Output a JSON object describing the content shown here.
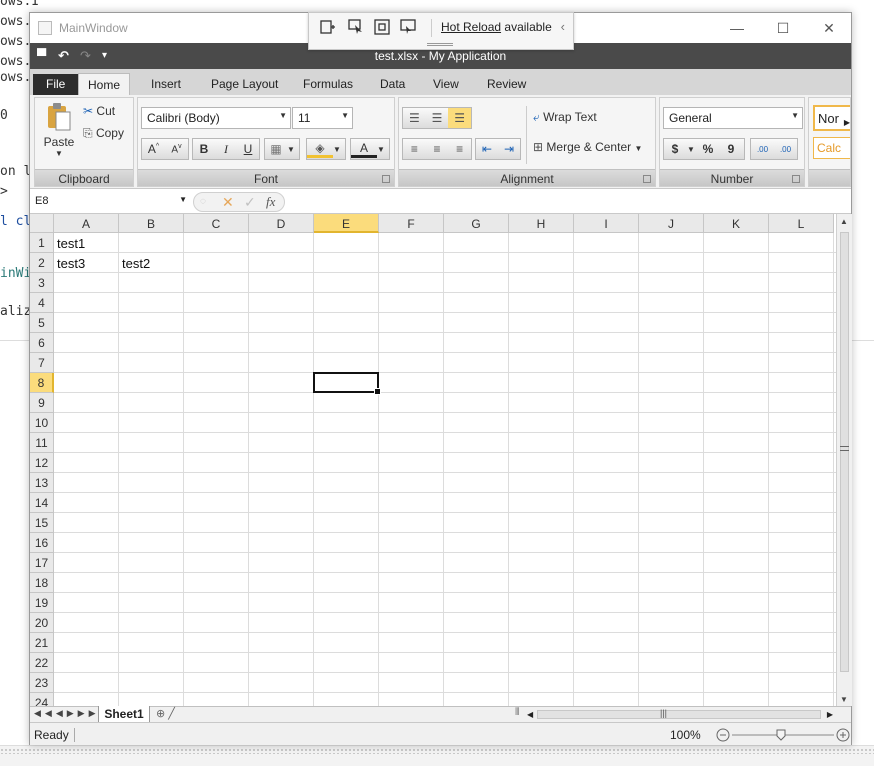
{
  "background": {
    "code_lines": [
      "ows.Input;",
      "ows.",
      "ows.",
      "ows.",
      "ows.",
      "0",
      "on l",
      ">",
      "l cl",
      "inWi",
      "aliz"
    ]
  },
  "window": {
    "title": "MainWindow",
    "minimize_glyph": "—",
    "maximize_glyph": "☐",
    "close_glyph": "✕"
  },
  "hot_reload": {
    "link": "Hot Reload",
    "text": "available",
    "chevron": "‹"
  },
  "qat": {
    "document_title": "test.xlsx - My Application",
    "save_glyph": "▀",
    "undo_glyph": "↶",
    "redo_glyph": "↷",
    "customize_glyph": "▾"
  },
  "tabs": [
    "File",
    "Home",
    "Insert",
    "Page Layout",
    "Formulas",
    "Data",
    "View",
    "Review"
  ],
  "ribbon": {
    "clipboard": {
      "label": "Clipboard",
      "paste": "Paste",
      "cut": "Cut",
      "copy": "Copy"
    },
    "font": {
      "label": "Font",
      "family": "Calibri (Body)",
      "size": "11",
      "bold": "B",
      "italic": "I",
      "underline": "U",
      "font_color": "A"
    },
    "alignment": {
      "label": "Alignment",
      "wrap_text": "Wrap Text",
      "merge_center": "Merge & Center"
    },
    "number": {
      "label": "Number",
      "format": "General",
      "currency": "$",
      "percent": "%",
      "comma": "9",
      "inc_decimal": ".00",
      "dec_decimal": ".00"
    },
    "styles": {
      "normal": "Nor",
      "calc": "Calc"
    }
  },
  "formula_bar": {
    "name_box": "E8",
    "cancel_glyph": "✕",
    "enter_glyph": "✓",
    "fx": "fx",
    "content": ""
  },
  "grid": {
    "columns": [
      "A",
      "B",
      "C",
      "D",
      "E",
      "F",
      "G",
      "H",
      "I",
      "J",
      "K",
      "L"
    ],
    "rows": [
      "1",
      "2",
      "3",
      "4",
      "5",
      "6",
      "7",
      "8",
      "9",
      "10",
      "11",
      "12",
      "13",
      "14",
      "15",
      "16",
      "17",
      "18",
      "19",
      "20",
      "21",
      "22",
      "23",
      "24"
    ],
    "selected_column": "E",
    "selected_row": "8",
    "cells": {
      "A1": "test1",
      "A2": "test3",
      "B2": "test2"
    }
  },
  "sheets": {
    "active": "Sheet1"
  },
  "status": {
    "ready": "Ready",
    "zoom": "100%"
  },
  "colors": {
    "header_selected": "#fbdc7c",
    "title_bar_dark": "#4a4a4a",
    "file_tab": "#2d2d2d"
  }
}
